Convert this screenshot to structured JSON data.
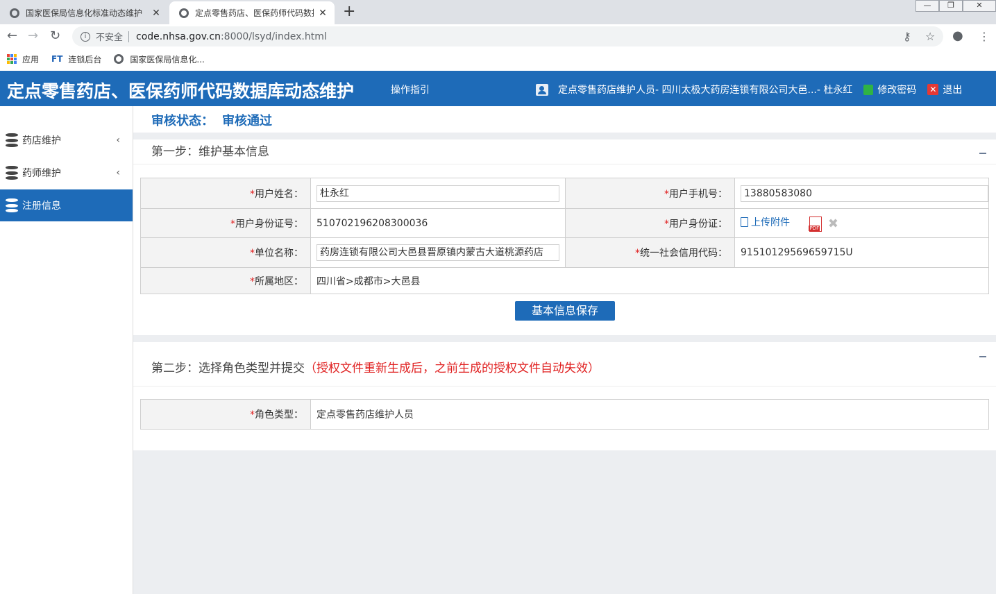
{
  "browser": {
    "tabs": [
      {
        "title": "国家医保局信息化标准动态维护"
      },
      {
        "title": "定点零售药店、医保药师代码数据"
      }
    ],
    "address": {
      "security_label": "不安全",
      "host": "code.nhsa.gov.cn",
      "path": ":8000/lsyd/index.html"
    },
    "bookmarks": [
      {
        "label": "应用",
        "icon": "apps-grid-icon"
      },
      {
        "label": "连锁后台",
        "icon": "ft-logo-icon"
      },
      {
        "label": "国家医保局信息化...",
        "icon": "globe-icon"
      }
    ]
  },
  "header": {
    "title": "定点零售药店、医保药师代码数据库动态维护",
    "guide": "操作指引",
    "user": "定点零售药店维护人员- 四川太极大药房连锁有限公司大邑...- 杜永红",
    "change_password": "修改密码",
    "logout": "退出",
    "color": "#1e6bb8"
  },
  "sidebar": {
    "items": [
      {
        "label": "药店维护",
        "expandable": true
      },
      {
        "label": "药师维护",
        "expandable": true
      },
      {
        "label": "注册信息",
        "active": true
      }
    ]
  },
  "status": {
    "label": "审核状态：",
    "value": "审核通过"
  },
  "step1": {
    "title": "第一步：维护基本信息",
    "fields": {
      "name_label": "用户姓名：",
      "name_value": "杜永红",
      "phone_label": "用户手机号：",
      "phone_value": "13880583080",
      "id_label": "用户身份证号：",
      "id_value": "510702196208300036",
      "id_card_label": "用户身份证：",
      "upload_label": "上传附件",
      "org_label": "单位名称：",
      "org_value": "药房连锁有限公司大邑县晋原镇内蒙古大道桃源药店",
      "credit_label": "统一社会信用代码：",
      "credit_value": "91510129569659715U",
      "region_label": "所属地区：",
      "region_value": "四川省>成都市>大邑县"
    },
    "save_button": "基本信息保存"
  },
  "step2": {
    "title": "第二步：选择角色类型并提交",
    "warning": "（授权文件重新生成后，之前生成的授权文件自动失效）",
    "role_label": "角色类型：",
    "role_value": "定点零售药店维护人员"
  },
  "required_mark": "*"
}
